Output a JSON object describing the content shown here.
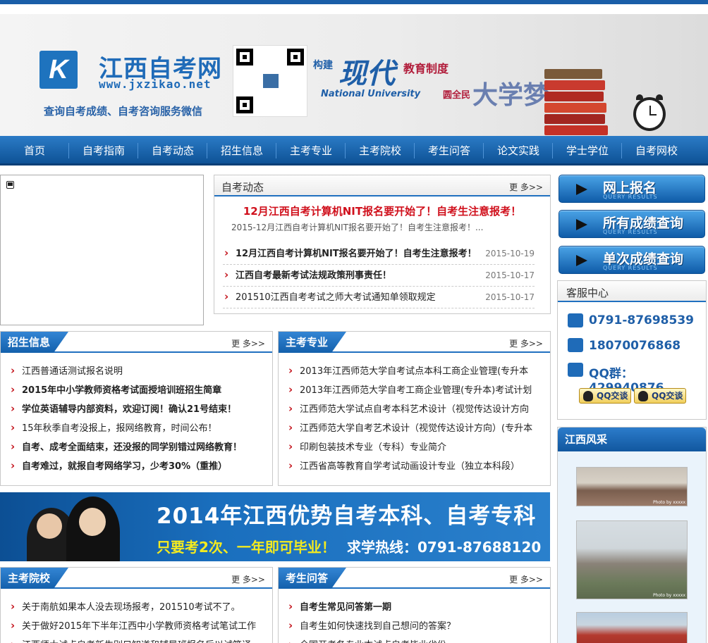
{
  "header": {
    "logo_mark": "K",
    "site_title": "江西自考网",
    "site_url": "www.jxzikao.net",
    "site_subtitle": "查询自考成绩、自考咨询服务微信",
    "slogan_build": "构建",
    "slogan_modern": "现代",
    "slogan_system": "教育制度",
    "slogan_national": "National University",
    "slogan_all": "圆全民",
    "slogan_dream": "大学梦"
  },
  "nav": [
    "首页",
    "自考指南",
    "自考动态",
    "招生信息",
    "主考专业",
    "主考院校",
    "考生问答",
    "论文实践",
    "学士学位",
    "自考网校"
  ],
  "more_label": "更 多>>",
  "news": {
    "title": "自考动态",
    "headline": "12月江西自考计算机NIT报名要开始了！自考生注意报考！",
    "headline_summary": "2015-12月江西自考计算机NIT报名要开始了！自考生注意报考！...",
    "items": [
      {
        "text": "12月江西自考计算机NIT报名要开始了！自考生注意报考！",
        "date": "2015-10-19",
        "bold": true
      },
      {
        "text": "江西自考最新考试法规政策刑事责任！",
        "date": "2015-10-17",
        "bold": true
      },
      {
        "text": "201510江西自考考试之师大考试通知单领取规定",
        "date": "2015-10-17",
        "bold": false
      }
    ]
  },
  "sidebar_buttons": [
    {
      "label": "网上报名",
      "sub": "QUERY RESULTS"
    },
    {
      "label": "所有成绩查询",
      "sub": "QUERY RESULTS"
    },
    {
      "label": "单次成绩查询",
      "sub": "QUERY RESULTS"
    }
  ],
  "service": {
    "title": "客服中心",
    "phone": "0791-87698539",
    "mobile": "18070076868",
    "qq": "QQ群：429940876",
    "qq_button": "QQ交谈"
  },
  "enroll": {
    "title": "招生信息",
    "items": [
      {
        "text": "江西普通话测试报名说明",
        "bold": false
      },
      {
        "text": "2015年中小学教师资格考试面授培训班招生简章",
        "bold": true
      },
      {
        "text": "学位英语辅导内部资料，欢迎订阅！确认21号结束！",
        "bold": true
      },
      {
        "text": "15年秋季自考没报上，报网络教育，时间公布！",
        "bold": false
      },
      {
        "text": "自考、成考全面结束，还没报的同学别错过网络教育！",
        "bold": true
      },
      {
        "text": "自考难过，就报自考网络学习，少考30%（重推）",
        "bold": true
      }
    ]
  },
  "majors": {
    "title": "主考专业",
    "items": [
      "2013年江西师范大学自考试点本科工商企业管理(专升本",
      "2013年江西师范大学自考工商企业管理(专升本)考试计划",
      "江西师范大学试点自考本科艺术设计（视觉传达设计方向",
      "江西师范大学自考艺术设计（视觉传达设计方向）(专升本",
      "印刷包装技术专业（专科）专业简介",
      "江西省高等教育自学考试动画设计专业（独立本科段）"
    ]
  },
  "banner": {
    "line1": "2014年江西优势自考本科、自考专科",
    "line2": "只要考2次、一年即可毕业！",
    "line3": "求学热线：0791-87688120"
  },
  "schools": {
    "title": "主考院校",
    "items": [
      "关于南航如果本人没去现场报考，201510考试不了。",
      "关于做好2015年下半年江西中小学教师资格考试笔试工作",
      "江西师大试点自考新生别只知道和辅导班报名后以试笔译"
    ]
  },
  "qa": {
    "title": "考生问答",
    "items": [
      {
        "text": "自考生常见问答第一期",
        "bold": true
      },
      {
        "text": "自考生如何快速找到自己想问的答案？",
        "bold": false
      },
      {
        "text": "全国开考各专业本试点自考毕业省份",
        "bold": false
      }
    ]
  },
  "gallery": {
    "title": "江西风采",
    "caption": "Photo by xxxxx"
  }
}
